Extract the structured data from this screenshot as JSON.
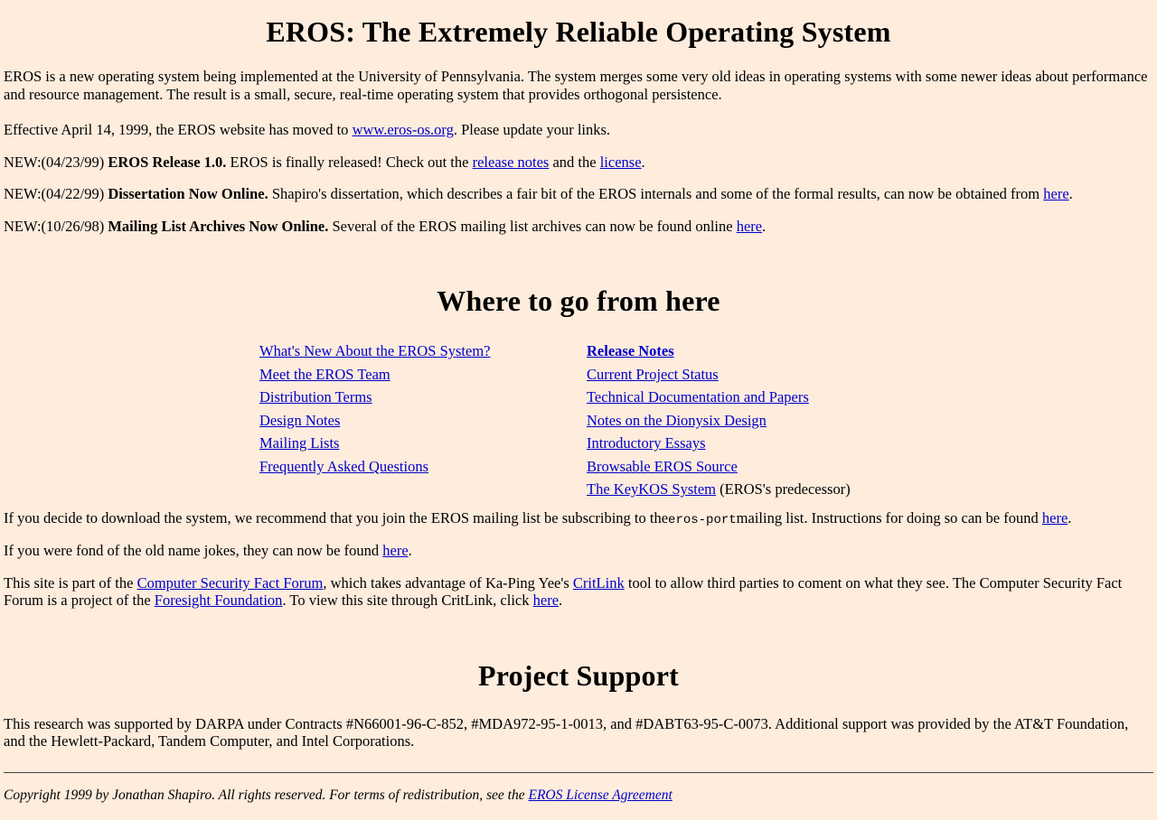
{
  "header": {
    "title": "EROS: The Extremely Reliable Operating System"
  },
  "intro": {
    "text": "EROS is a new operating system being implemented at the University of Pennsylvania. The system merges some very old ideas in operating systems with some newer ideas about performance and resource management. The result is a small, secure, real-time operating system that provides orthogonal persistence."
  },
  "notice": {
    "before_link": "Effective April 14, 1999, the EROS website has moved to ",
    "link_label": "www.eros-os.org",
    "after_link": ". Please update your links."
  },
  "news": [
    {
      "prefix": "NEW:(04/23/99)",
      "headline": "EROS Release 1.0.",
      "body_1": "EROS is finally released! Check out the ",
      "link_1": "release notes",
      "body_2": " and the ",
      "link_2": "license",
      "body_3": "."
    },
    {
      "prefix": "NEW:(04/22/99)",
      "headline": "Dissertation Now Online.",
      "body_1": "Shapiro's dissertation, which describes a fair bit of the EROS internals and some of the formal results, can now be obtained from ",
      "link_1": "here",
      "body_2": ".",
      "link_2": "",
      "body_3": ""
    },
    {
      "prefix": "NEW:(10/26/98)",
      "headline": "Mailing List Archives Now Online.",
      "body_1": "Several of the EROS mailing list archives can now be found online ",
      "link_1": "here",
      "body_2": ".",
      "link_2": "",
      "body_3": ""
    }
  ],
  "where_to_go": {
    "title": "Where to go from here",
    "left_column": [
      {
        "label": "What's New About the EROS System?",
        "bold": false,
        "suffix": ""
      },
      {
        "label": "Meet the EROS Team",
        "bold": false,
        "suffix": ""
      },
      {
        "label": "Distribution Terms",
        "bold": false,
        "suffix": ""
      },
      {
        "label": "Design Notes",
        "bold": false,
        "suffix": ""
      },
      {
        "label": "Mailing Lists",
        "bold": false,
        "suffix": ""
      },
      {
        "label": "Frequently Asked Questions",
        "bold": false,
        "suffix": ""
      }
    ],
    "right_column": [
      {
        "label": "Release Notes",
        "bold": true,
        "suffix": ""
      },
      {
        "label": "Current Project Status",
        "bold": false,
        "suffix": ""
      },
      {
        "label": "Technical Documentation and Papers",
        "bold": false,
        "suffix": ""
      },
      {
        "label": "Notes on the Dionysix Design",
        "bold": false,
        "suffix": ""
      },
      {
        "label": "Introductory Essays",
        "bold": false,
        "suffix": ""
      },
      {
        "label": "Browsable EROS Source",
        "bold": false,
        "suffix": ""
      },
      {
        "label": "The KeyKOS System",
        "bold": false,
        "suffix": " (EROS's predecessor)"
      }
    ]
  },
  "mailing_list": {
    "part_1": "If you decide to download the system, we recommend that you join the EROS mailing list be subscribing to the",
    "mono": "eros-port",
    "part_2": "mailing list. Instructions for doing so can be found ",
    "link": "here",
    "part_3": "."
  },
  "name_jokes": {
    "part_1": "If you were fond of the old name jokes, they can now be found ",
    "link": "here",
    "part_2": "."
  },
  "critlink": {
    "part_1": "This site is part of the ",
    "link_1": "Computer Security Fact Forum",
    "part_2": ", which takes advantage of Ka-Ping Yee's ",
    "link_2": "CritLink",
    "part_3": " tool to allow third parties to coment on what they see. The Computer Security Fact Forum is a project of the ",
    "link_3": "Foresight Foundation",
    "part_4": ". To view this site through CritLink, click ",
    "link_4": "here",
    "part_5": "."
  },
  "project_support": {
    "title": "Project Support",
    "text": "This research was supported by DARPA under Contracts #N66001-96-C-852, #MDA972-95-1-0013, and #DABT63-95-C-0073. Additional support was provided by the AT&T Foundation, and the Hewlett-Packard, Tandem Computer, and Intel Corporations."
  },
  "footer": {
    "text": "Copyright 1999 by Jonathan Shapiro. All rights reserved. For terms of redistribution, see the ",
    "link": "EROS License Agreement"
  },
  "colors": {
    "background": "#FEECDD",
    "link": "#0000CC",
    "text": "#000000",
    "rule": "#444444"
  }
}
